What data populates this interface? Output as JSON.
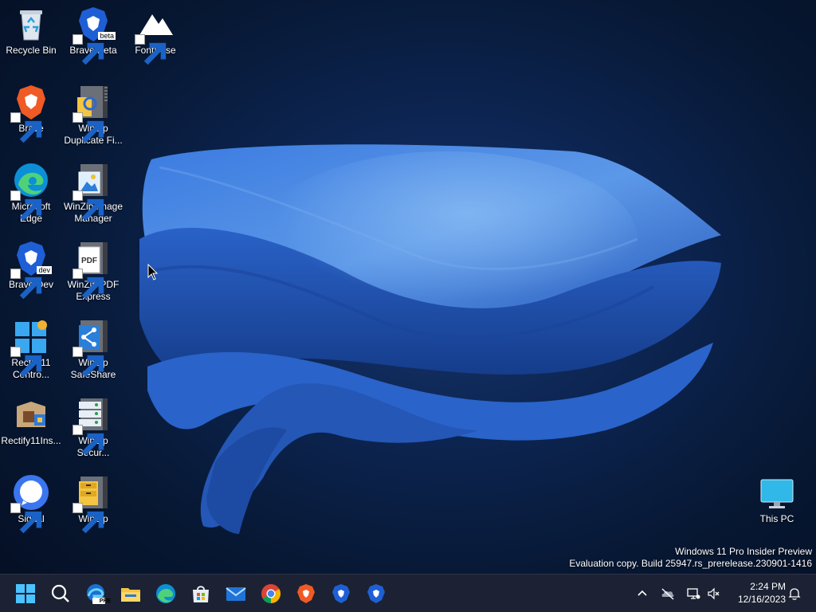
{
  "desktop": {
    "icons": [
      {
        "label": "Recycle Bin"
      },
      {
        "label": "Brave Beta",
        "badge": "beta"
      },
      {
        "label": "FontBase"
      },
      {
        "label": "Brave"
      },
      {
        "label": "WinZip Duplicate Fi..."
      },
      {
        "label": "Microsoft Edge"
      },
      {
        "label": "WinZip Image Manager"
      },
      {
        "label": "Brave Dev",
        "badge": "dev"
      },
      {
        "label": "WinZip PDF Express",
        "glyph_text": "PDF"
      },
      {
        "label": "Rectify11 Contro..."
      },
      {
        "label": "WinZip SafeShare"
      },
      {
        "label": "Rectify11Ins..."
      },
      {
        "label": "WinZip Secur..."
      },
      {
        "label": "Signal"
      },
      {
        "label": "WinZip"
      },
      {
        "label": "This PC"
      }
    ]
  },
  "watermark": {
    "line1": "Windows 11 Pro Insider Preview",
    "line2": "Evaluation copy. Build 25947.rs_prerelease.230901-1416"
  },
  "taskbar": {
    "apps": [
      {
        "name": "start-icon"
      },
      {
        "name": "search-icon"
      },
      {
        "name": "edge-canary-icon",
        "badge": "PRE"
      },
      {
        "name": "file-explorer-icon"
      },
      {
        "name": "edge-icon"
      },
      {
        "name": "microsoft-store-icon"
      },
      {
        "name": "mail-icon"
      },
      {
        "name": "chrome-icon"
      },
      {
        "name": "brave-icon"
      },
      {
        "name": "brave-beta-icon"
      },
      {
        "name": "brave-dev-icon"
      }
    ],
    "tray": {
      "icons": [
        "chevron-up-icon",
        "onedrive-icon",
        "network-icon",
        "volume-muted-icon",
        "notification-bell-icon"
      ],
      "time": "2:24 PM",
      "date": "12/16/2023"
    }
  },
  "colors": {
    "taskbar_bg": "#1c2233",
    "wallpaper_accent": "#2f6fd0",
    "brave_orange": "#f05a24",
    "brave_blue": "#1f5fd6"
  }
}
